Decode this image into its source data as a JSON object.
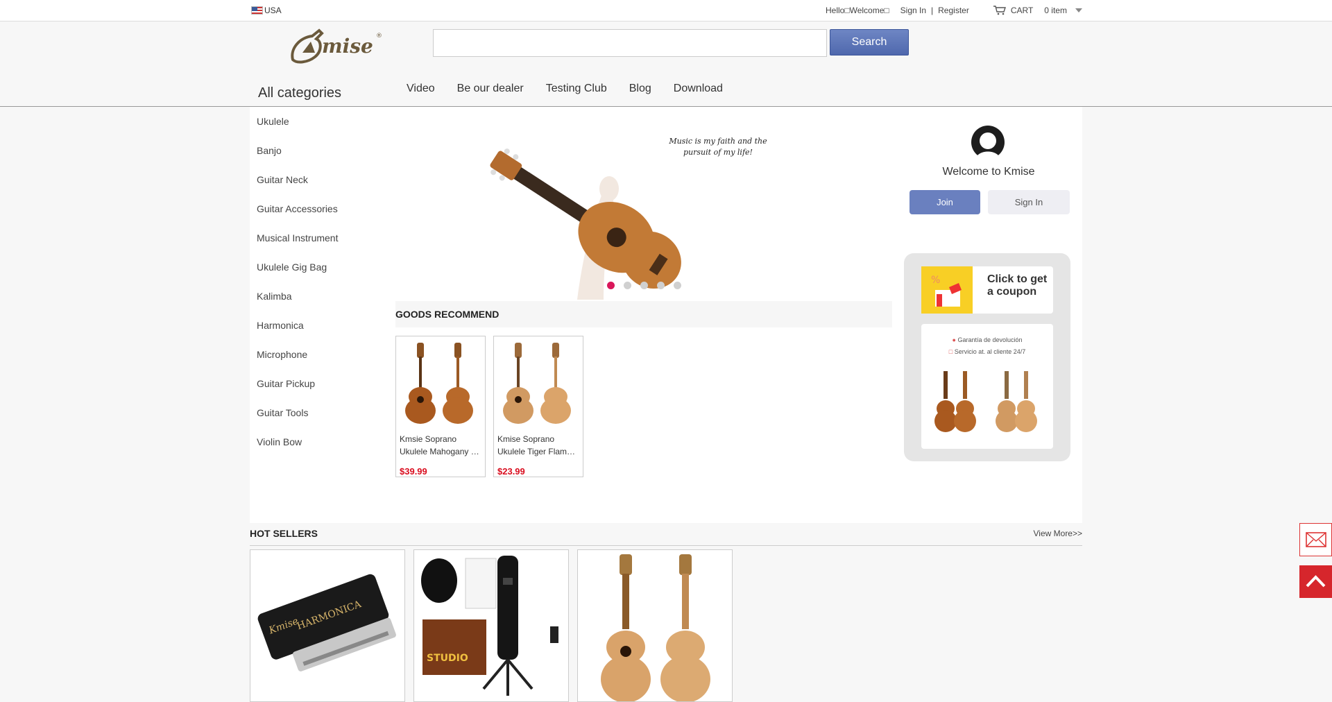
{
  "topbar": {
    "region": "USA",
    "greeting": "Hello\u0000Welcome\u0000",
    "sign_in": "Sign In",
    "separator": "|",
    "register": "Register",
    "cart_label": "CART",
    "cart_count": "0 item"
  },
  "header": {
    "logo_text": "Kmise",
    "search_placeholder": "",
    "search_button": "Search"
  },
  "nav": {
    "all_categories": "All categories",
    "links": [
      "Video",
      "Be our dealer",
      "Testing Club",
      "Blog",
      "Download"
    ]
  },
  "categories": [
    "Ukulele",
    "Banjo",
    "Guitar Neck",
    "Guitar Accessories",
    "Musical Instrument",
    "Ukulele Gig Bag",
    "Kalimba",
    "Harmonica",
    "Microphone",
    "Guitar Pickup",
    "Guitar Tools",
    "Violin Bow"
  ],
  "banner": {
    "quote_line1": "Music is my faith and the",
    "quote_line2": "pursuit of my life!",
    "slide_count": 5,
    "active_slide": 1
  },
  "goods_recommend": {
    "title": "GOODS RECOMMEND",
    "items": [
      {
        "name1": "Kmsie Soprano",
        "name2": "Ukulele Mahogany …",
        "price": "$39.99"
      },
      {
        "name1": "Kmise Soprano",
        "name2": "Ukulele Tiger Flame…",
        "price": "$23.99"
      }
    ]
  },
  "user_panel": {
    "welcome": "Welcome to Kmise",
    "join": "Join",
    "sign_in": "Sign In"
  },
  "coupon": {
    "text_line1": "Click to get",
    "text_line2": "a coupon",
    "promo_line1": "Garantía de devolución",
    "promo_line2": "Servicio at. al cliente 24/7"
  },
  "hot_sellers": {
    "title": "HOT SELLERS",
    "view_more": "View More>>"
  },
  "colors": {
    "accent_blue": "#5a72b5",
    "price_red": "#d90d1e",
    "dot_active": "#d9175a",
    "float_red": "#d6262c"
  }
}
